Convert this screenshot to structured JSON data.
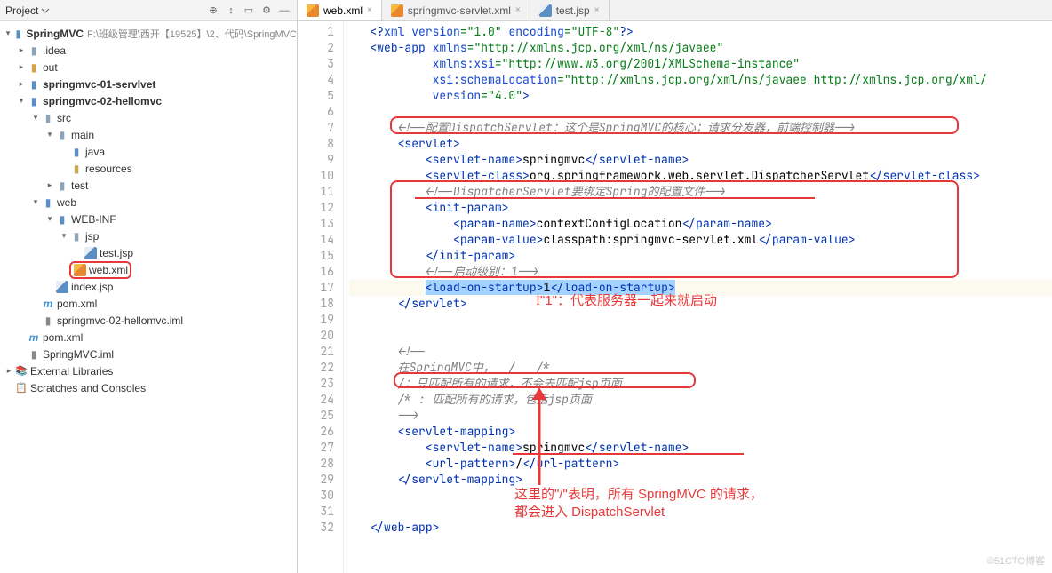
{
  "sidebar": {
    "title": "Project",
    "tree": {
      "root": {
        "label": "SpringMVC",
        "path": "F:\\班级管理\\西开【19525】\\2、代码\\SpringMVC"
      },
      "idea": ".idea",
      "out": "out",
      "mod1": "springmvc-01-servlvet",
      "mod2": "springmvc-02-hellomvc",
      "src": "src",
      "main": "main",
      "java": "java",
      "resources": "resources",
      "test": "test",
      "web": "web",
      "webinf": "WEB-INF",
      "jsp": "jsp",
      "testjsp": "test.jsp",
      "webxml": "web.xml",
      "indexjsp": "index.jsp",
      "pomxml": "pom.xml",
      "iml": "springmvc-02-hellomvc.iml",
      "pomxml2": "pom.xml",
      "rootiml": "SpringMVC.iml",
      "extlib": "External Libraries",
      "scratch": "Scratches and Consoles"
    }
  },
  "tabs": [
    {
      "label": "web.xml",
      "active": true
    },
    {
      "label": "springmvc-servlet.xml",
      "active": false
    },
    {
      "label": "test.jsp",
      "active": false
    }
  ],
  "code": {
    "lines": 32,
    "l1": {
      "a": "<?",
      "b": "xml version",
      "c": "=\"1.0\" ",
      "d": "encoding",
      "e": "=\"UTF-8\"",
      "f": "?>"
    },
    "l2": {
      "a": "<",
      "b": "web-app ",
      "c": "xmlns",
      "d": "=\"http://xmlns.jcp.org/xml/ns/javaee\""
    },
    "l3": {
      "a": "xmlns:xsi",
      "b": "=\"http://www.w3.org/2001/XMLSchema-instance\""
    },
    "l4": {
      "a": "xsi:schemaLocation",
      "b": "=\"http://xmlns.jcp.org/xml/ns/javaee http://xmlns.jcp.org/xml/"
    },
    "l5": {
      "a": "version",
      "b": "=\"4.0\"",
      "c": ">"
    },
    "l7": "<!--配置DispatchServlet：这个是SpringMVC的核心；请求分发器，前端控制器-->",
    "l8": {
      "a": "<",
      "b": "servlet",
      "c": ">"
    },
    "l9": {
      "a": "<",
      "b": "servlet-name",
      "c": ">",
      "d": "springmvc",
      "e": "</",
      "f": "servlet-name",
      "g": ">"
    },
    "l10": {
      "a": "<",
      "b": "servlet-class",
      "c": ">",
      "d": "org.springframework.web.servlet.DispatcherServlet",
      "e": "</",
      "f": "servlet-class",
      "g": ">"
    },
    "l11": "<!--DispatcherServlet要绑定Spring的配置文件-->",
    "l12": {
      "a": "<",
      "b": "init-param",
      "c": ">"
    },
    "l13": {
      "a": "<",
      "b": "param-name",
      "c": ">",
      "d": "contextConfigLocation",
      "e": "</",
      "f": "param-name",
      "g": ">"
    },
    "l14": {
      "a": "<",
      "b": "param-value",
      "c": ">",
      "d": "classpath:springmvc-servlet.xml",
      "e": "</",
      "f": "param-value",
      "g": ">"
    },
    "l15": {
      "a": "</",
      "b": "init-param",
      "c": ">"
    },
    "l16": "<!--启动级别：1-->",
    "l17": {
      "a": "<",
      "b": "load-on-startup",
      "c": ">",
      "d": "1",
      "e": "</",
      "f": "load-on-startup",
      "g": ">"
    },
    "l18": {
      "a": "</",
      "b": "servlet",
      "c": ">"
    },
    "l21": "<!--",
    "l22": "在SpringMVC中，  /   /*",
    "l23": "/：只匹配所有的请求，不会去匹配jsp页面",
    "l24": "/* : 匹配所有的请求，包括jsp页面",
    "l25": "-->",
    "l26": {
      "a": "<",
      "b": "servlet-mapping",
      "c": ">"
    },
    "l27": {
      "a": "<",
      "b": "servlet-name",
      "c": ">",
      "d": "springmvc",
      "e": "</",
      "f": "servlet-name",
      "g": ">"
    },
    "l28": {
      "a": "<",
      "b": "url-pattern",
      "c": ">",
      "d": "/",
      "e": "</",
      "f": "url-pattern",
      "g": ">"
    },
    "l29": {
      "a": "</",
      "b": "servlet-mapping",
      "c": ">"
    },
    "l32": {
      "a": "</",
      "b": "web-app",
      "c": ">"
    }
  },
  "annotations": {
    "a1": "\"1\"：代表服务器一起来就启动",
    "a2": "这里的\"/\"表明，所有 SpringMVC 的请求，",
    "a3": "都会进入 DispatchServlet"
  },
  "watermark": "©51CTO博客"
}
